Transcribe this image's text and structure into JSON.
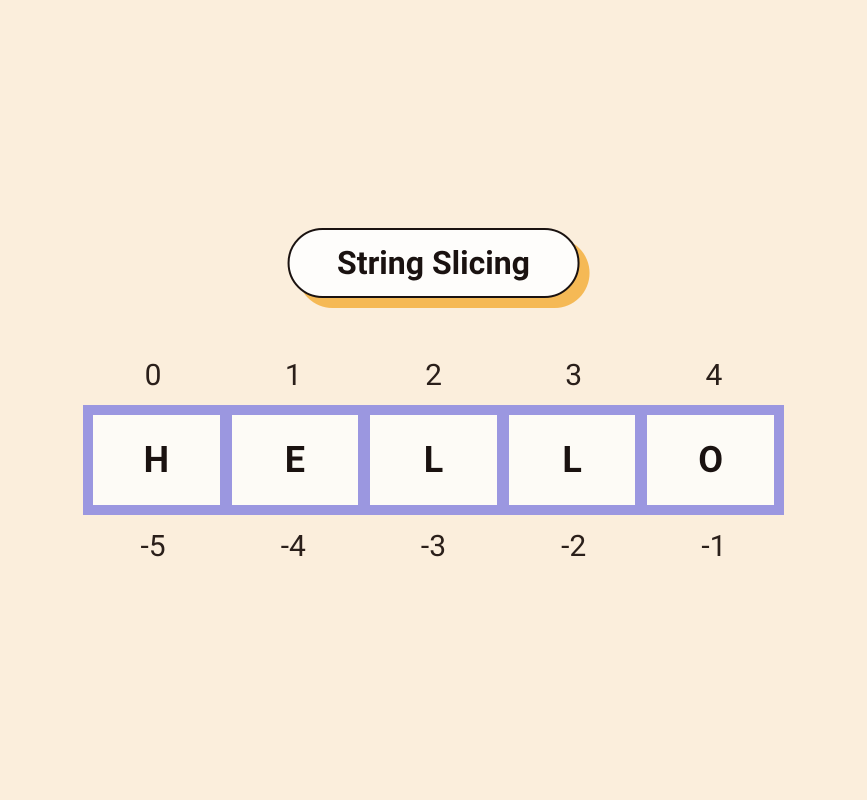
{
  "title": "String Slicing",
  "cells": [
    {
      "char": "H",
      "pos": "0",
      "neg": "-5"
    },
    {
      "char": "E",
      "pos": "1",
      "neg": "-4"
    },
    {
      "char": "L",
      "pos": "2",
      "neg": "-3"
    },
    {
      "char": "L",
      "pos": "3",
      "neg": "-2"
    },
    {
      "char": "O",
      "pos": "4",
      "neg": "-1"
    }
  ]
}
